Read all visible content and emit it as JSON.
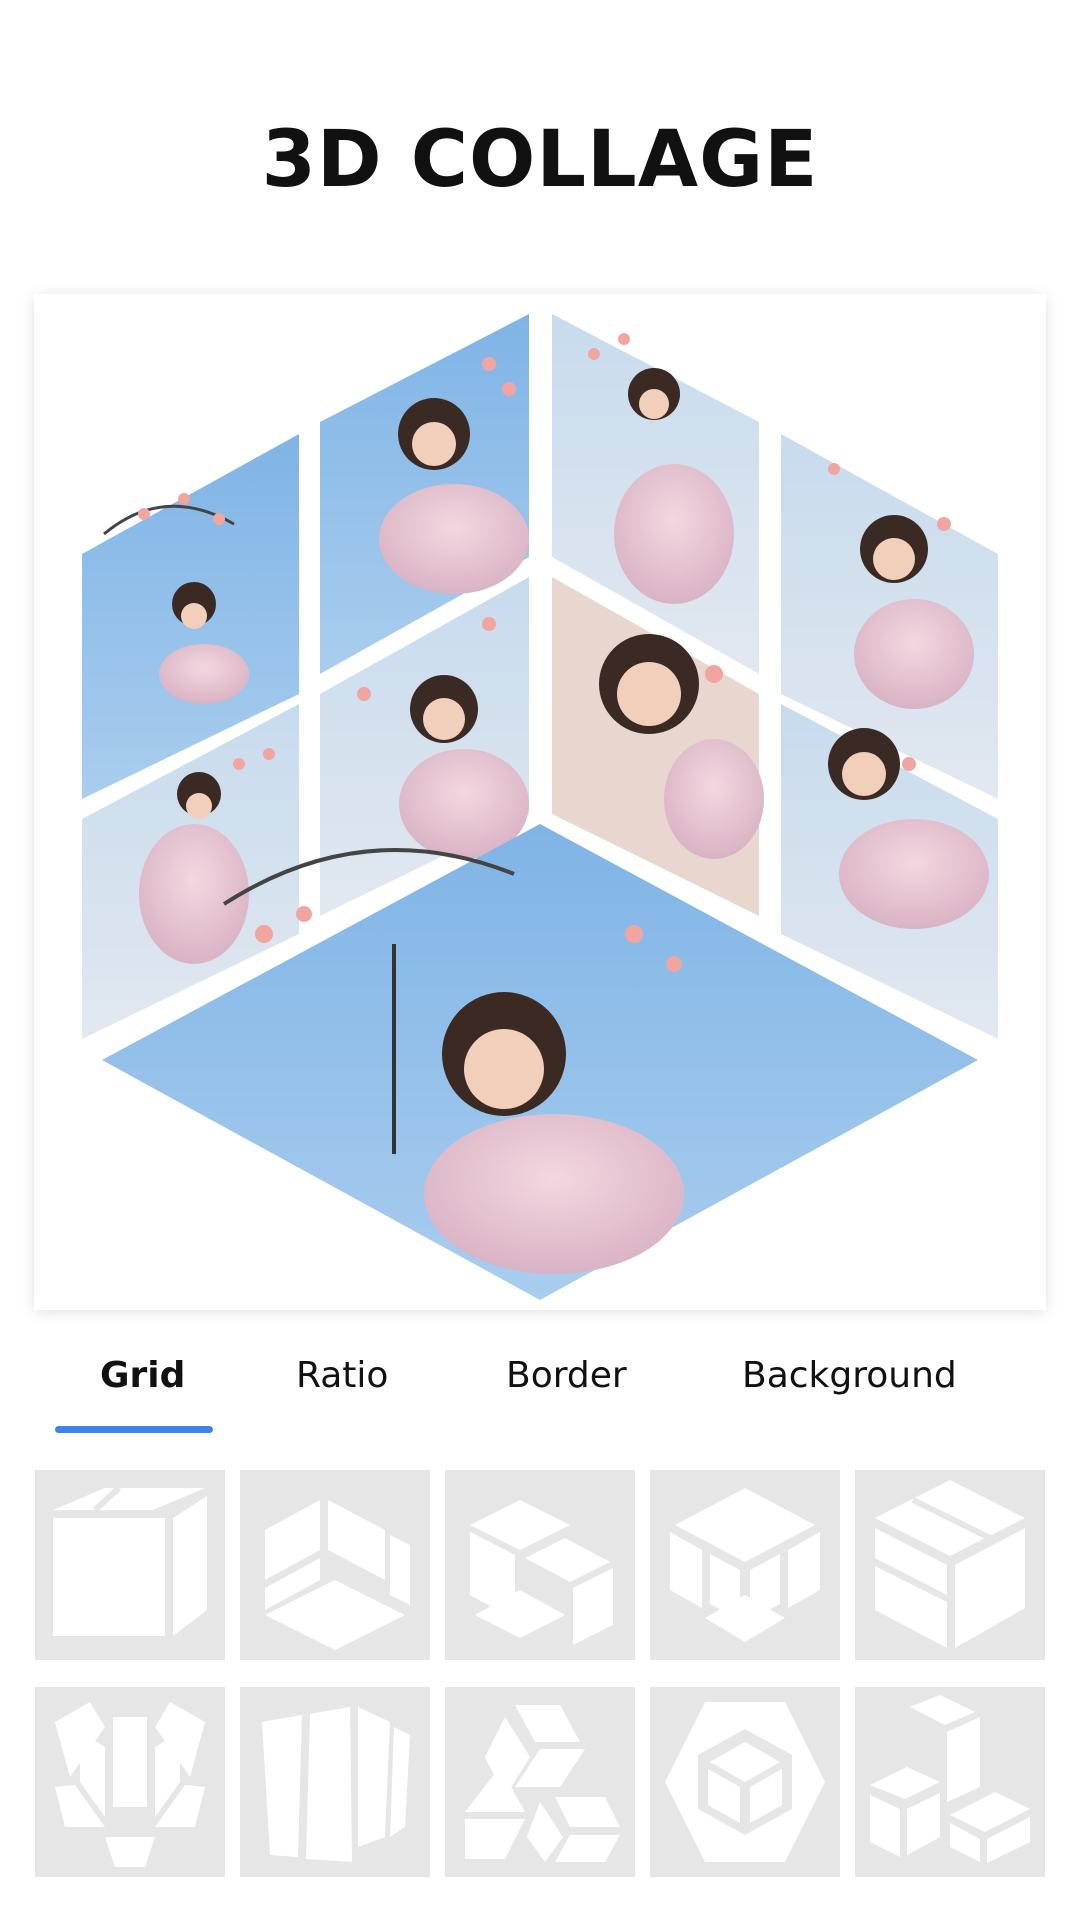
{
  "header": {
    "title": "3D COLLAGE"
  },
  "collage": {
    "border_color": "#ffffff",
    "sky_color": "#8fbde6",
    "layout": "hexagon-cube-7-photos"
  },
  "tabs": {
    "items": [
      {
        "label": "Grid",
        "active": true
      },
      {
        "label": "Ratio",
        "active": false
      },
      {
        "label": "Border",
        "active": false
      },
      {
        "label": "Background",
        "active": false
      }
    ],
    "accent_color": "#3a86e8"
  },
  "templates": {
    "tile_background": "#e6e6e6",
    "icon_color": "#ffffff",
    "items": [
      "cube-basic-icon",
      "cube-split-icon",
      "cube-stack-icon",
      "cube-hex-icon",
      "cube-slab-icon",
      "shield-facets-icon",
      "cube-panels-icon",
      "triple-diamond-icon",
      "nested-hex-icon",
      "stairs-blocks-icon"
    ]
  }
}
